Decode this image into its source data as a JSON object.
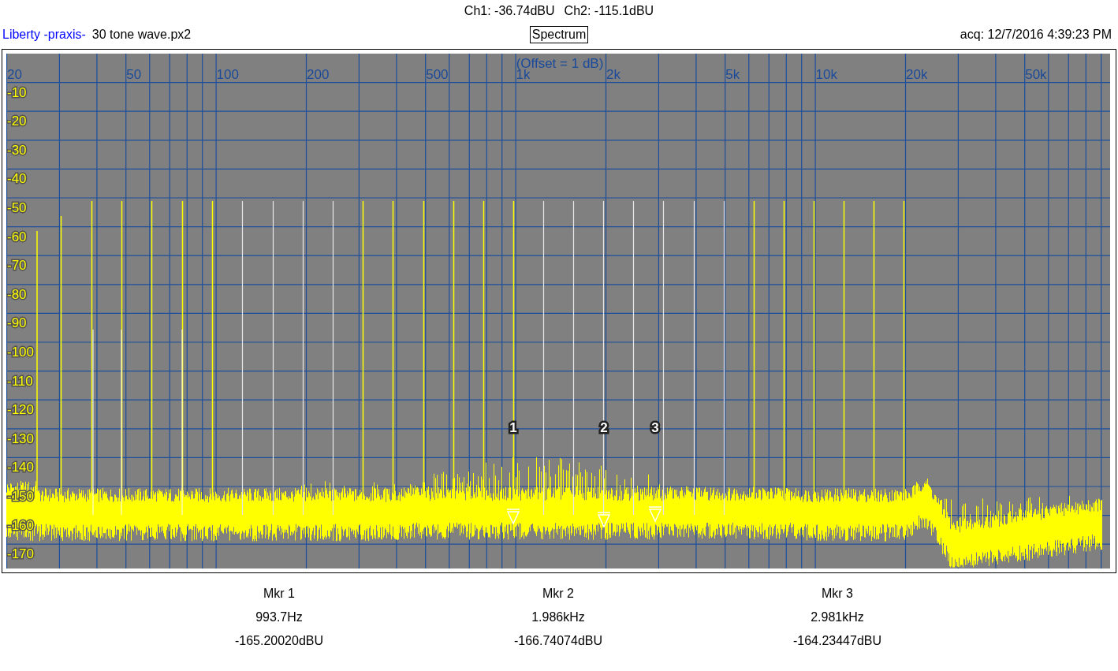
{
  "header": {
    "channel_readings": [
      "Ch1: -36.74dBU",
      "Ch2: -115.1dBU"
    ],
    "brand": "Liberty -praxis-",
    "file": "30 tone wave.px2",
    "view": "Spectrum",
    "acquired": "acq: 12/7/2016 4:39:23 PM"
  },
  "plot": {
    "note": "(Offset = 1 dB)",
    "x_labels": [
      "20",
      "50",
      "100",
      "200",
      "500",
      "1k",
      "2k",
      "5k",
      "10k",
      "20k",
      "50k"
    ],
    "y_labels": [
      "-10",
      "-20",
      "-30",
      "-40",
      "-50",
      "-60",
      "-70",
      "-80",
      "-90",
      "-100",
      "-110",
      "-120",
      "-130",
      "-140",
      "-150",
      "-160",
      "-170"
    ],
    "markers": [
      {
        "label": "1"
      },
      {
        "label": "2"
      },
      {
        "label": "3"
      }
    ]
  },
  "readouts": [
    {
      "title": "Mkr 1",
      "frequency": "993.7Hz",
      "value": "-165.20020dBU"
    },
    {
      "title": "Mkr 2",
      "frequency": "1.986kHz",
      "value": "-166.74074dBU"
    },
    {
      "title": "Mkr 3",
      "frequency": "2.981kHz",
      "value": "-164.23447dBU"
    }
  ]
}
